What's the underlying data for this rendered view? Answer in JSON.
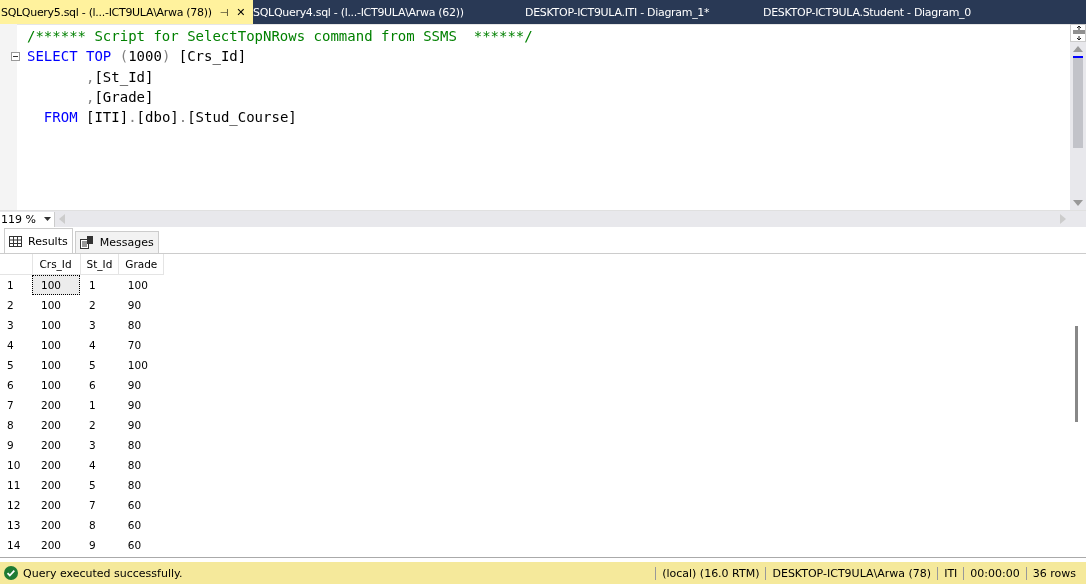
{
  "doc_tabs": [
    {
      "label": "SQLQuery5.sql - (l...-ICT9ULA\\Arwa (78))",
      "selected": true,
      "pin": "⊣",
      "close": "✕"
    },
    {
      "label": "SQLQuery4.sql - (l...-ICT9ULA\\Arwa (62))",
      "selected": false
    },
    {
      "label": "DESKTOP-ICT9ULA.ITI - Diagram_1*",
      "selected": false
    },
    {
      "label": "DESKTOP-ICT9ULA.Student - Diagram_0",
      "selected": false
    }
  ],
  "editor": {
    "lines": [
      {
        "fold": false,
        "tokens": [
          {
            "kind": "comment",
            "text": "/****** Script for SelectTopNRows command from SSMS  ******/"
          }
        ]
      },
      {
        "fold": true,
        "tokens": [
          {
            "kind": "keyword",
            "text": "SELECT TOP"
          },
          {
            "kind": "punct",
            "text": " ("
          },
          {
            "kind": "plain",
            "text": "1000"
          },
          {
            "kind": "punct",
            "text": ")"
          },
          {
            "kind": "plain",
            "text": " [Crs_Id]"
          }
        ]
      },
      {
        "fold": false,
        "tokens": [
          {
            "kind": "punct",
            "text": "       ,"
          },
          {
            "kind": "plain",
            "text": "[St_Id]"
          }
        ]
      },
      {
        "fold": false,
        "tokens": [
          {
            "kind": "punct",
            "text": "       ,"
          },
          {
            "kind": "plain",
            "text": "[Grade]"
          }
        ]
      },
      {
        "fold": false,
        "tokens": [
          {
            "kind": "keyword",
            "text": "  FROM"
          },
          {
            "kind": "plain",
            "text": " [ITI]"
          },
          {
            "kind": "punct",
            "text": "."
          },
          {
            "kind": "plain",
            "text": "[dbo]"
          },
          {
            "kind": "punct",
            "text": "."
          },
          {
            "kind": "plain",
            "text": "[Stud_Course]"
          }
        ]
      }
    ]
  },
  "zoom": "119 %",
  "result_tabs": [
    {
      "label": "Results",
      "selected": true,
      "kind": "grid"
    },
    {
      "label": "Messages",
      "selected": false,
      "kind": "messages"
    }
  ],
  "grid": {
    "columns": [
      "Crs_Id",
      "St_Id",
      "Grade"
    ],
    "rows": [
      {
        "num": "1",
        "cells": [
          "100",
          "1",
          "100"
        ],
        "selected": true
      },
      {
        "num": "2",
        "cells": [
          "100",
          "2",
          "90"
        ],
        "selected": false
      },
      {
        "num": "3",
        "cells": [
          "100",
          "3",
          "80"
        ],
        "selected": false
      },
      {
        "num": "4",
        "cells": [
          "100",
          "4",
          "70"
        ],
        "selected": false
      },
      {
        "num": "5",
        "cells": [
          "100",
          "5",
          "100"
        ],
        "selected": false
      },
      {
        "num": "6",
        "cells": [
          "100",
          "6",
          "90"
        ],
        "selected": false
      },
      {
        "num": "7",
        "cells": [
          "200",
          "1",
          "90"
        ],
        "selected": false
      },
      {
        "num": "8",
        "cells": [
          "200",
          "2",
          "90"
        ],
        "selected": false
      },
      {
        "num": "9",
        "cells": [
          "200",
          "3",
          "80"
        ],
        "selected": false
      },
      {
        "num": "10",
        "cells": [
          "200",
          "4",
          "80"
        ],
        "selected": false
      },
      {
        "num": "11",
        "cells": [
          "200",
          "5",
          "80"
        ],
        "selected": false
      },
      {
        "num": "12",
        "cells": [
          "200",
          "7",
          "60"
        ],
        "selected": false
      },
      {
        "num": "13",
        "cells": [
          "200",
          "8",
          "60"
        ],
        "selected": false
      },
      {
        "num": "14",
        "cells": [
          "200",
          "9",
          "60"
        ],
        "selected": false
      }
    ]
  },
  "status_bar": {
    "message": "Query executed successfully.",
    "fields": [
      "(local) (16.0 RTM)",
      "DESKTOP-ICT9ULA\\Arwa (78)",
      "ITI",
      "00:00:00",
      "36 rows"
    ]
  }
}
